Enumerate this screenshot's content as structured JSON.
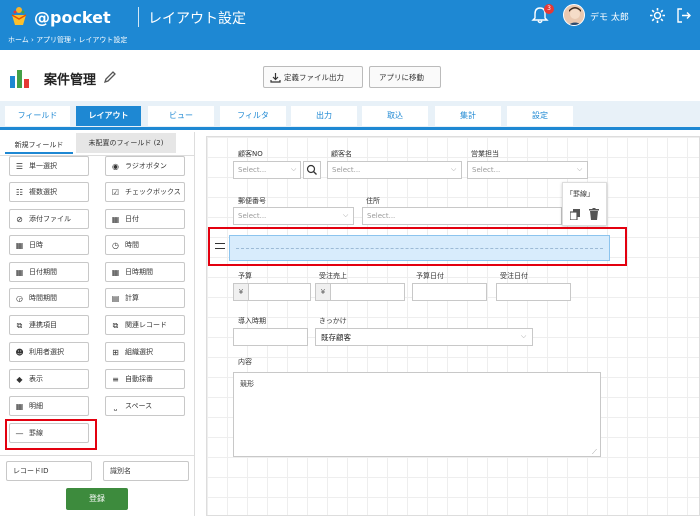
{
  "header": {
    "logo": "@pocket",
    "title": "レイアウト設定",
    "notification_count": "3",
    "user_name": "デモ 太郎",
    "breadcrumb": [
      "ホーム",
      "アプリ管理",
      "レイアウト設定"
    ],
    "colors": {
      "primary": "#1e88d3",
      "badge": "#e53935"
    }
  },
  "page": {
    "title": "案件管理",
    "export_button": "定義ファイル出力",
    "move_button": "アプリに移動"
  },
  "tabs": [
    "フィールド",
    "レイアウト",
    "ビュー",
    "フィルタ",
    "出力",
    "取込",
    "集計",
    "設定"
  ],
  "active_tab": "レイアウト",
  "left_panel": {
    "tab_new": "新規フィールド",
    "tab_unplaced": "未配置のフィールド (2)",
    "fields": [
      {
        "icon": "list-icon",
        "label": "単一選択"
      },
      {
        "icon": "radio-icon",
        "label": "ラジオボタン"
      },
      {
        "icon": "checklist-icon",
        "label": "複数選択"
      },
      {
        "icon": "checkbox-icon",
        "label": "チェックボックス"
      },
      {
        "icon": "paperclip-icon",
        "label": "添付ファイル"
      },
      {
        "icon": "calendar-icon",
        "label": "日付"
      },
      {
        "icon": "calendar-clock-icon",
        "label": "日時"
      },
      {
        "icon": "clock-icon",
        "label": "時間"
      },
      {
        "icon": "calendar-range-icon",
        "label": "日付期間"
      },
      {
        "icon": "calendar-range-icon",
        "label": "日時期間"
      },
      {
        "icon": "clock-range-icon",
        "label": "時間期間"
      },
      {
        "icon": "calculator-icon",
        "label": "計算"
      },
      {
        "icon": "link-doc-icon",
        "label": "連携項目"
      },
      {
        "icon": "related-record-icon",
        "label": "関連レコード"
      },
      {
        "icon": "users-icon",
        "label": "利用者選択"
      },
      {
        "icon": "org-chart-icon",
        "label": "組織選択"
      },
      {
        "icon": "label-icon",
        "label": "表示"
      },
      {
        "icon": "numbered-list-icon",
        "label": "自動採番"
      },
      {
        "icon": "table-icon",
        "label": "明細"
      },
      {
        "icon": "space-icon",
        "label": "スペース"
      },
      {
        "icon": "rule-line-icon",
        "label": "罫線"
      }
    ],
    "bottom_fields": [
      "レコードID",
      "識別名"
    ],
    "register_button": "登録"
  },
  "form": {
    "customer_no": "顧客NO",
    "customer_name": "顧客名",
    "sales_rep": "営業担当",
    "postal_code": "郵便番号",
    "address": "住所",
    "select_placeholder": "Select...",
    "rule_popup_title": "「罫線」",
    "budget": "予算",
    "order_sales": "受注売上",
    "budget_date": "予算日付",
    "order_date": "受注日付",
    "yen": "¥",
    "intro_period": "導入時期",
    "trigger": "きっかけ",
    "trigger_value": "既存顧客",
    "content": "内容",
    "content_value": "競形"
  }
}
